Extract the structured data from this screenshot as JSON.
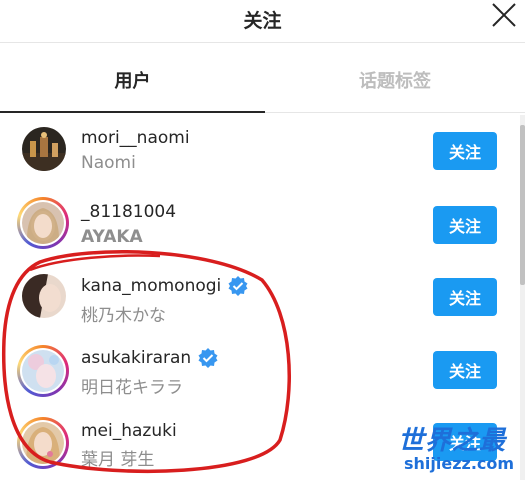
{
  "header": {
    "title": "关注",
    "close_icon": "close-icon"
  },
  "tabs": [
    {
      "label": "用户",
      "active": true
    },
    {
      "label": "话题标签",
      "active": false
    }
  ],
  "users": [
    {
      "username": "mori__naomi",
      "fullname": "Naomi",
      "verified": false,
      "follow_label": "关注"
    },
    {
      "username": "_81181004",
      "fullname": "AYAKA",
      "verified": false,
      "follow_label": "关注"
    },
    {
      "username": "kana_momonogi",
      "fullname": "桃乃木かな",
      "verified": true,
      "follow_label": "关注"
    },
    {
      "username": "asukakiraran",
      "fullname": "明日花キララ",
      "verified": true,
      "follow_label": "关注"
    },
    {
      "username": "mei_hazuki",
      "fullname": "葉月 芽生",
      "verified": false,
      "follow_label": "关注"
    }
  ],
  "watermark": {
    "title": "世界之最",
    "url": "shijiezz.com"
  },
  "colors": {
    "follow_button": "#1a9af2",
    "verified_badge": "#3897f0",
    "annotation": "#d81e1e"
  }
}
